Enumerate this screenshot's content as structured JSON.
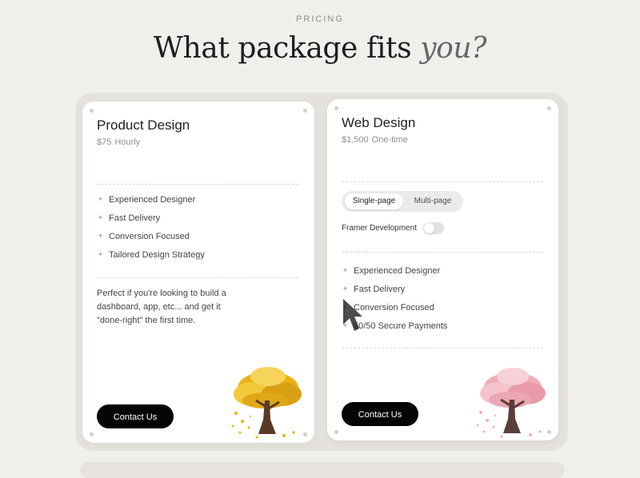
{
  "header": {
    "eyebrow": "PRICING",
    "title_main": "What package fits ",
    "title_accent": "you?"
  },
  "cards": [
    {
      "title": "Product Design",
      "price": "$75",
      "billing": "Hourly",
      "features": [
        "Experienced Designer",
        "Fast Delivery",
        "Conversion Focused",
        "Tailored Design Strategy"
      ],
      "description": "Perfect if you're looking to build a dashboard, app, etc... and get it \"done-right\" the first time.",
      "button_label": "Contact Us",
      "tree_color": "#e9b319"
    },
    {
      "title": "Web Design",
      "price": "$1,500",
      "billing": "One-time",
      "segment_options": [
        "Single-page",
        "Multi-page"
      ],
      "selected_segment": "Single-page",
      "toggle_label": "Framer Development",
      "toggle_on": false,
      "features": [
        "Experienced Designer",
        "Fast Delivery",
        "Conversion Focused",
        "50/50 Secure Payments"
      ],
      "button_label": "Contact Us",
      "tree_color": "#f0aeb9"
    }
  ],
  "icons": {
    "feature_bullet": "sparkle-icon",
    "cursor": "mouse-cursor-icon"
  },
  "colors": {
    "background": "#f1efec",
    "button": "#050505",
    "card": "#ffffff"
  }
}
